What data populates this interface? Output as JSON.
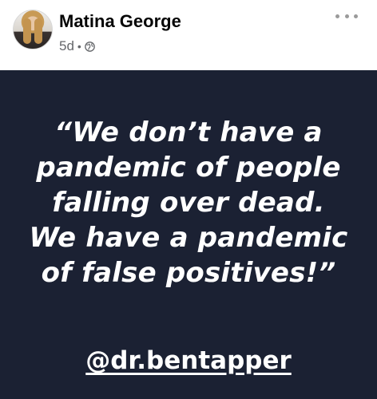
{
  "post": {
    "author_name": "Matina George",
    "timestamp": "5d",
    "separator": "•",
    "privacy_icon": "globe-icon",
    "more_icon": "more-horizontal-icon"
  },
  "image": {
    "quote_lines": [
      "“We don’t have a",
      "pandemic of people",
      "falling over dead.",
      "We have a pandemic",
      "of false positives!”"
    ],
    "handle": "@dr.bentapper",
    "background_color": "#1b2133",
    "text_color": "#ffffff"
  }
}
